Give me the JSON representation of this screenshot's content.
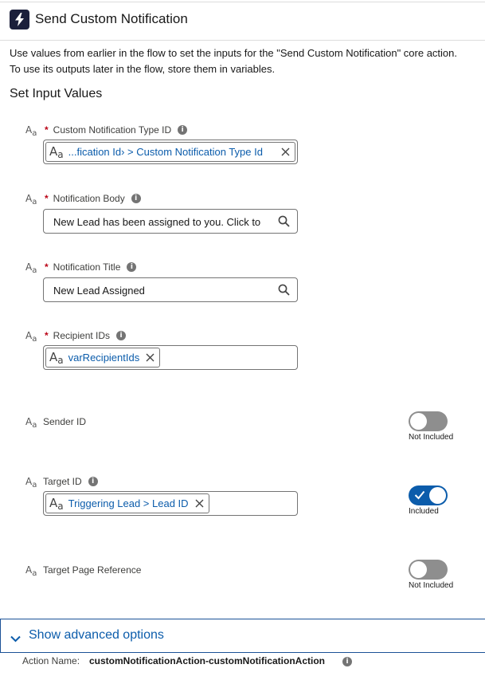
{
  "header": {
    "title": "Send Custom Notification",
    "icon": "lightning-icon"
  },
  "description": {
    "line1": "Use values from earlier in the flow to set the inputs for the \"Send Custom Notification\" core action.",
    "line2": "To use its outputs later in the flow, store them in variables."
  },
  "section_title": "Set Input Values",
  "type_icon_text": "A",
  "type_icon_sub": "a",
  "fields": {
    "type_id": {
      "label": "Custom Notification Type ID",
      "required_mark": "*",
      "pill_text": "...fication Id› > Custom Notification Type Id"
    },
    "body": {
      "label": "Notification Body",
      "required_mark": "*",
      "value": "New Lead  has been assigned to you. Click to"
    },
    "title": {
      "label": "Notification Title",
      "required_mark": "*",
      "value": "New Lead Assigned"
    },
    "recipients": {
      "label": "Recipient IDs",
      "required_mark": "*",
      "pill_text": "varRecipientIds"
    },
    "sender": {
      "label": "Sender ID",
      "toggle_caption": "Not Included",
      "included": false
    },
    "target": {
      "label": "Target ID",
      "pill_text": "Triggering Lead > Lead ID",
      "toggle_caption": "Included",
      "included": true
    },
    "page_ref": {
      "label": "Target Page Reference",
      "toggle_caption": "Not Included",
      "included": false
    }
  },
  "advanced": {
    "label": "Show advanced options"
  },
  "footer": {
    "action_label": "Action Name:",
    "action_value": "customNotificationAction-customNotificationAction"
  },
  "colors": {
    "accent": "#0b5cab",
    "required": "#ba0517",
    "header_icon_bg": "#1b1f3b"
  }
}
